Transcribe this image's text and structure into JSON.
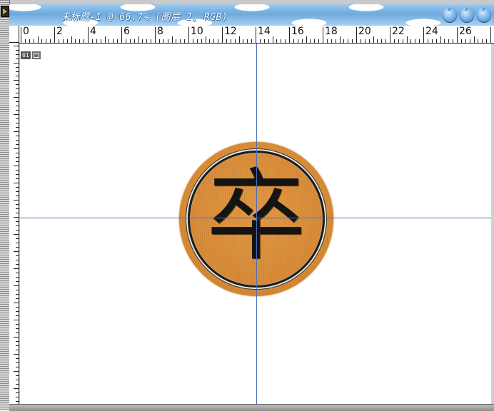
{
  "window": {
    "title": "未标题-1 @ 66.7% (图层 2, RGB)"
  },
  "ruler": {
    "labels": [
      "0",
      "2",
      "4",
      "6",
      "8",
      "10",
      "12",
      "14",
      "16",
      "18",
      "20",
      "22",
      "24",
      "26"
    ]
  },
  "canvas": {
    "layer_number": "01"
  },
  "piece": {
    "character": "卒"
  },
  "colors": {
    "guide": "#4a6fb8",
    "piece_wood": "#d88d36",
    "title_bar": "#6ea9df"
  }
}
